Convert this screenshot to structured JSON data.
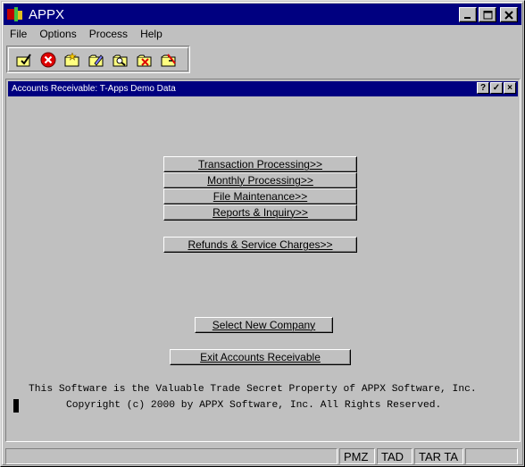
{
  "window": {
    "title": "APPX"
  },
  "titlebar_buttons": {
    "minimize": "_",
    "maximize": "□",
    "close": "×"
  },
  "menu": {
    "items": [
      {
        "label": "File"
      },
      {
        "label": "Options"
      },
      {
        "label": "Process"
      },
      {
        "label": "Help"
      }
    ]
  },
  "toolbar": {
    "tools": [
      {
        "icon": "check-folder-icon"
      },
      {
        "icon": "cancel-icon"
      },
      {
        "icon": "folder-star-icon"
      },
      {
        "icon": "folder-edit-icon"
      },
      {
        "icon": "folder-search-icon"
      },
      {
        "icon": "folder-delete-icon"
      },
      {
        "icon": "folder-remove-icon"
      }
    ]
  },
  "child": {
    "title": "Accounts Receivable: T-Apps Demo Data",
    "buttons": {
      "help": "?",
      "ok": "✓",
      "close": "×"
    }
  },
  "main": {
    "transaction": "Transaction Processing>>",
    "monthly": "Monthly Processing>>",
    "file_maint": "File Maintenance>>",
    "reports": "Reports & Inquiry>>",
    "refunds": "Refunds & Service Charges>>",
    "select_company": "Select New Company",
    "exit": "Exit Accounts Receivable"
  },
  "notice": {
    "line1": "This Software is the Valuable Trade Secret Property of APPX Software, Inc.",
    "line2": "Copyright (c) 2000 by APPX Software, Inc. All Rights Reserved."
  },
  "status": {
    "cells": [
      "",
      "PMZ",
      "TAD",
      "TAR TA",
      ""
    ]
  }
}
